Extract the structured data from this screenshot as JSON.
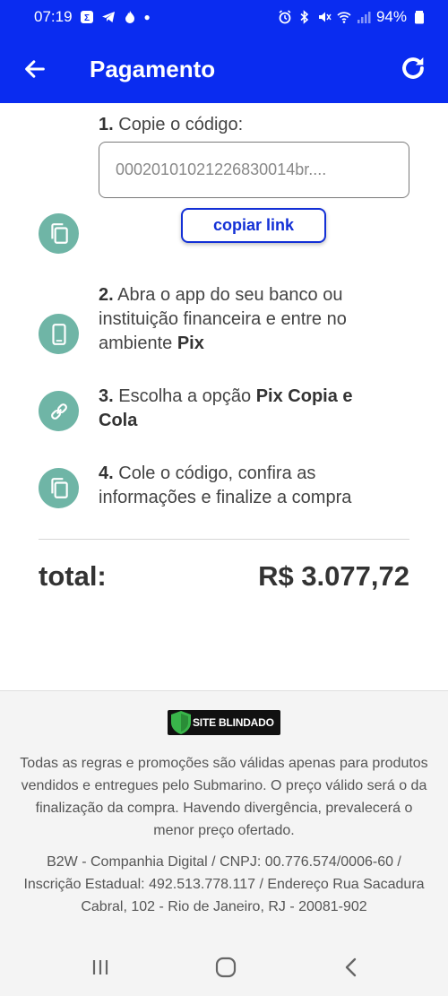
{
  "status": {
    "time": "07:19",
    "battery": "94%"
  },
  "header": {
    "title": "Pagamento"
  },
  "steps": {
    "step1_num": "1.",
    "step1_text": "Copie o código:",
    "code_value": "00020101021226830014br....",
    "copy_button": "copiar link",
    "step2_num": "2.",
    "step2_text": "Abra o app do seu banco ou instituição financeira e entre no ambiente",
    "step2_bold": "Pix",
    "step3_num": "3.",
    "step3_text": "Escolha a opção",
    "step3_bold": "Pix Copia e Cola",
    "step4_num": "4.",
    "step4_text": "Cole o código, confira as informações e finalize a compra"
  },
  "total": {
    "label": "total:",
    "value": "R$ 3.077,72"
  },
  "footer": {
    "badge": "SITE BLINDADO",
    "disclaimer": "Todas as regras e promoções são válidas apenas para produtos vendidos e entregues pelo Submarino. O preço válido será o da finalização da compra. Havendo divergência, prevalecerá o menor preço ofertado.",
    "company": "B2W - Companhia Digital / CNPJ: 00.776.574/0006-60 / Inscrição Estadual: 492.513.778.117 / Endereço Rua Sacadura Cabral, 102 - Rio de Janeiro, RJ - 20081-902"
  },
  "colors": {
    "primary": "#0a2cf0",
    "icon_circle": "#6fb5a6",
    "button_border": "#1330d6"
  },
  "icons": {
    "back": "arrow-left-icon",
    "refresh": "refresh-icon",
    "step1": "copy-icon",
    "step2": "smartphone-icon",
    "step3": "link-icon",
    "step4": "copy-icon"
  }
}
